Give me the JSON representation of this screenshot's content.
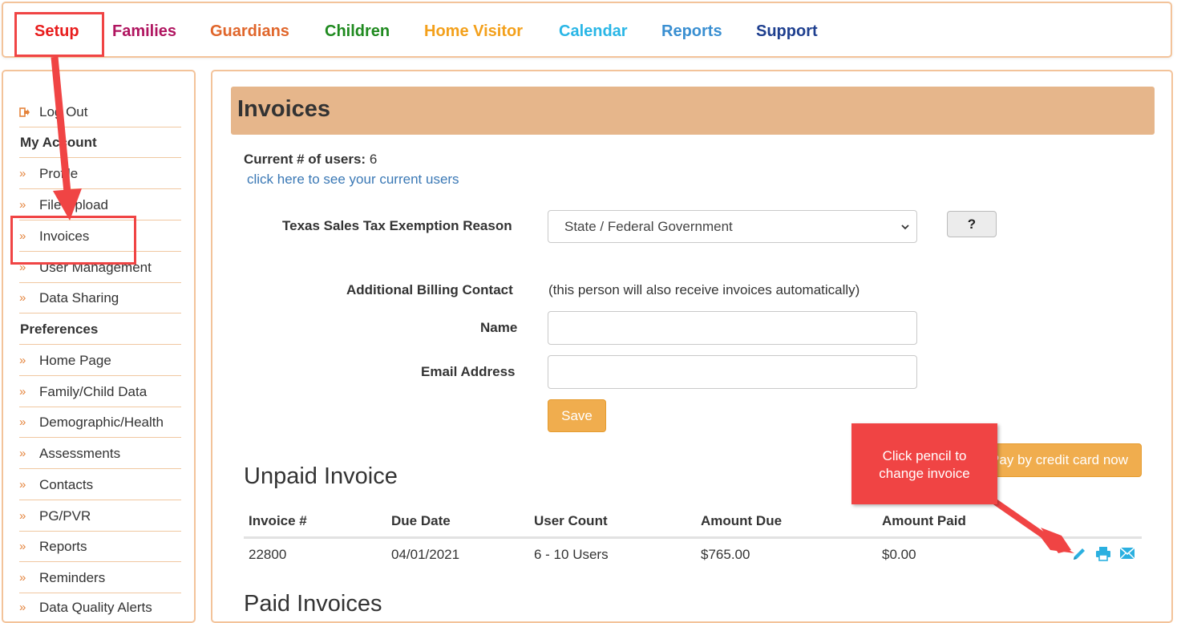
{
  "top_nav": [
    {
      "label": "Setup",
      "color": "#e81d1d"
    },
    {
      "label": "Families",
      "color": "#b01560"
    },
    {
      "label": "Guardians",
      "color": "#e0662b"
    },
    {
      "label": "Children",
      "color": "#1f8a1f"
    },
    {
      "label": "Home Visitor",
      "color": "#f3a01b"
    },
    {
      "label": "Calendar",
      "color": "#29b6e6"
    },
    {
      "label": "Reports",
      "color": "#3a8fd1"
    },
    {
      "label": "Support",
      "color": "#1e3f8f"
    }
  ],
  "sidebar": {
    "logout": "Log Out",
    "items": [
      {
        "label": "My Account",
        "header": true
      },
      {
        "label": "Profile"
      },
      {
        "label": "File Upload"
      },
      {
        "label": "Invoices"
      },
      {
        "label": "User Management"
      },
      {
        "label": "Data Sharing"
      },
      {
        "label": "Preferences",
        "header": true
      },
      {
        "label": "Home Page"
      },
      {
        "label": "Family/Child Data"
      },
      {
        "label": "Demographic/Health"
      },
      {
        "label": "Assessments"
      },
      {
        "label": "Contacts"
      },
      {
        "label": "PG/PVR"
      },
      {
        "label": "Reports"
      },
      {
        "label": "Reminders"
      },
      {
        "label": "Data Quality Alerts"
      }
    ]
  },
  "page": {
    "title": "Invoices",
    "users_label": "Current # of users:",
    "users_count": "6",
    "users_link": "click here to see your current users",
    "tax_label": "Texas Sales Tax Exemption Reason",
    "tax_value": "State / Federal Government",
    "help_button": "?",
    "billing_label": "Additional Billing Contact",
    "billing_note": "(this person will also receive invoices automatically)",
    "name_label": "Name",
    "name_value": "",
    "email_label": "Email Address",
    "email_value": "",
    "save_button": "Save",
    "pay_button": "Pay by credit card now",
    "unpaid_heading": "Unpaid Invoice",
    "paid_heading": "Paid Invoices"
  },
  "unpaid_table": {
    "columns": [
      "Invoice #",
      "Due Date",
      "User Count",
      "Amount Due",
      "Amount Paid"
    ],
    "rows": [
      [
        "22800",
        "04/01/2021",
        "6 - 10 Users",
        "$765.00",
        "$0.00"
      ]
    ],
    "row_icons": [
      "pencil-icon",
      "print-icon",
      "envelope-icon"
    ]
  },
  "annotation": {
    "callout_text_1": "Click pencil to",
    "callout_text_2": "change invoice",
    "color": "#f04444"
  }
}
